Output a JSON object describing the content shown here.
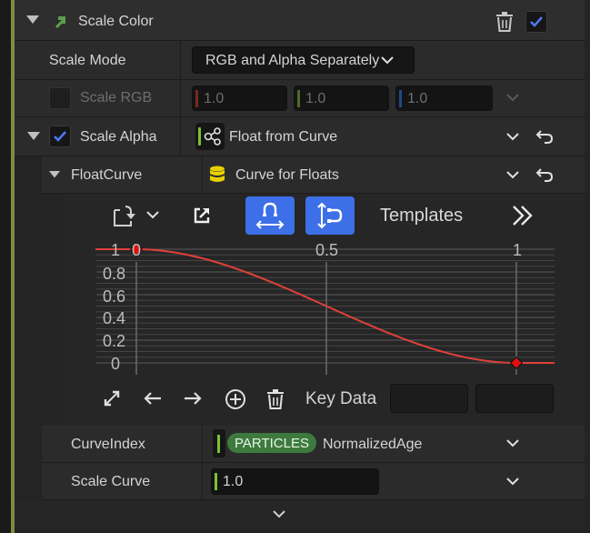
{
  "header": {
    "title": "Scale Color"
  },
  "scale_mode": {
    "label": "Scale Mode",
    "value": "RGB and Alpha Separately"
  },
  "scale_rgb": {
    "label": "Scale RGB",
    "r": "1.0",
    "g": "1.0",
    "b": "1.0"
  },
  "scale_alpha": {
    "label": "Scale Alpha",
    "value": "Float from Curve"
  },
  "float_curve": {
    "label": "FloatCurve",
    "value": "Curve for Floats"
  },
  "curve_toolbar": {
    "templates_label": "Templates"
  },
  "curve_editor": {
    "x_ticks": [
      "0",
      "0.5",
      "1"
    ],
    "y_ticks": [
      "1",
      "0.8",
      "0.6",
      "0.4",
      "0.2",
      "0"
    ],
    "key_data_label": "Key Data",
    "curve_color": "#e0403a",
    "chart_data": {
      "type": "line",
      "xlim": [
        0,
        1
      ],
      "ylim": [
        0,
        1
      ],
      "keys": [
        {
          "x": 0,
          "y": 1
        },
        {
          "x": 1,
          "y": 0
        }
      ],
      "interpolation": "smooth"
    }
  },
  "curve_index": {
    "label": "CurveIndex",
    "namespace": "PARTICLES",
    "value": "NormalizedAge"
  },
  "scale_curve": {
    "label": "Scale Curve",
    "value": "1.0"
  },
  "colors": {
    "accent": "#3d6fe8",
    "green": "#7cc13a",
    "panel": "#2b2b2b"
  }
}
